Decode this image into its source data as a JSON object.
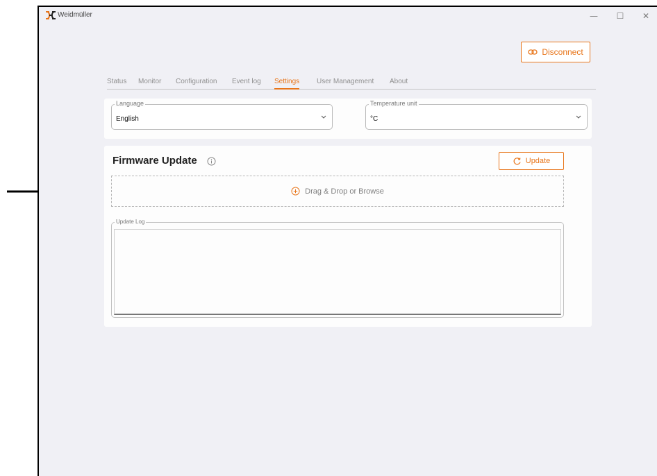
{
  "window": {
    "title": "Weidmüller",
    "controls": {
      "minimize": "—",
      "maximize": "☐",
      "close": "✕"
    }
  },
  "header": {
    "disconnect_label": "Disconnect"
  },
  "tabs": [
    {
      "label": "Status",
      "active": false
    },
    {
      "label": "Monitor",
      "active": false
    },
    {
      "label": "Configuration",
      "active": false
    },
    {
      "label": "Event log",
      "active": false
    },
    {
      "label": "Settings",
      "active": true
    },
    {
      "label": "User Management",
      "active": false
    },
    {
      "label": "About",
      "active": false
    }
  ],
  "settings": {
    "language": {
      "label": "Language",
      "value": "English"
    },
    "temperature_unit": {
      "label": "Temperature unit",
      "value": "°C"
    }
  },
  "firmware": {
    "title": "Firmware Update",
    "update_label": "Update",
    "dropzone_label": "Drag & Drop or Browse",
    "log_label": "Update Log",
    "log_content": ""
  },
  "icons": {
    "logo": "weidmuller-logo-icon",
    "disconnect": "link-icon",
    "info": "info-icon",
    "update": "refresh-icon",
    "dropzone": "plus-circle-icon",
    "chevron": "chevron-down-icon"
  },
  "colors": {
    "accent": "#e8751a",
    "background": "#f0f0f5",
    "card": "#fdfdfd"
  }
}
